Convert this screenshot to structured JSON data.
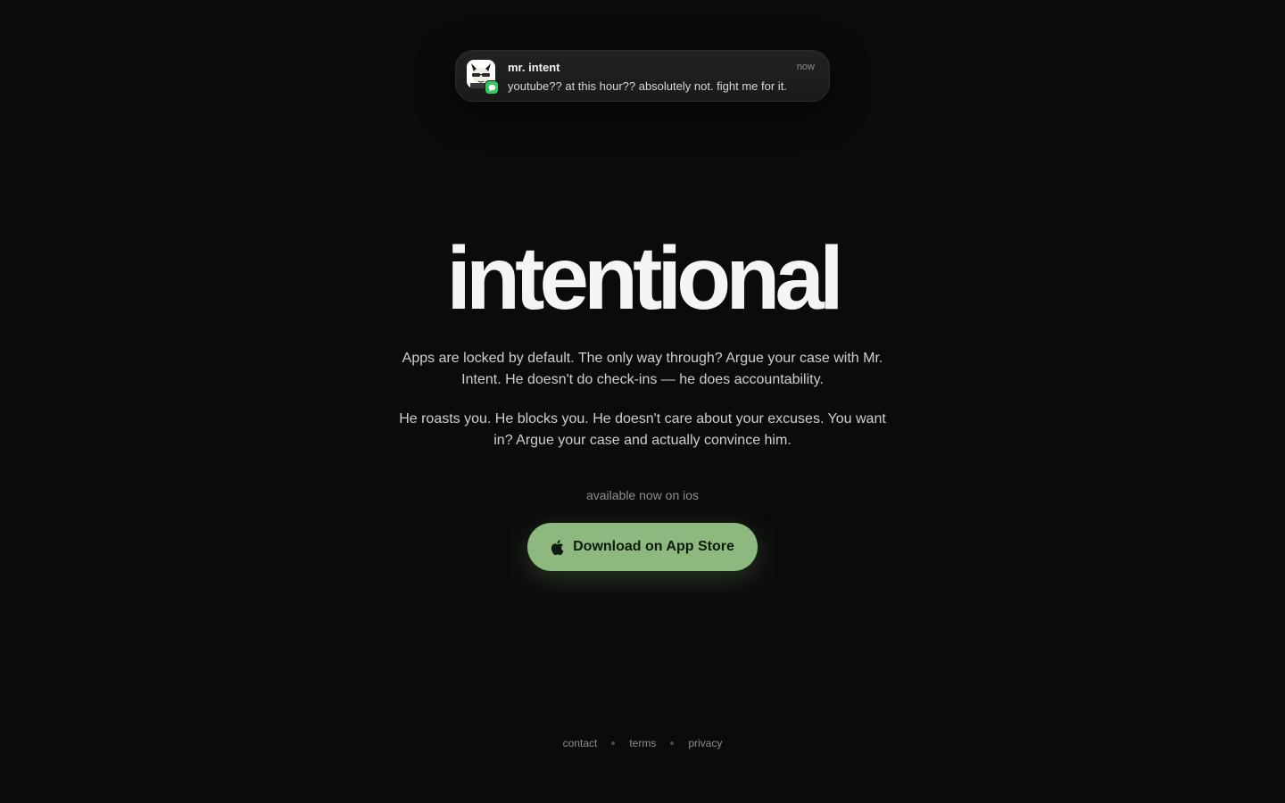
{
  "notification": {
    "sender": "mr. intent",
    "time": "now",
    "message": "youtube?? at this hour?? absolutely not. fight me for it.",
    "avatar_icon": "cat-mascot-icon",
    "badge_icon": "message-bubble-icon",
    "badge_color": "#34c759"
  },
  "hero": {
    "title": "intentional",
    "paragraph_1": "Apps are locked by default. The only way through? Argue your case with Mr. Intent. He doesn't do check-ins — he does accountability.",
    "paragraph_2": "He roasts you. He blocks you. He doesn't care about your excuses. You want in? Argue your case and actually convince him."
  },
  "availability": "available now on ios",
  "cta": {
    "label": "Download on App Store",
    "icon": "apple-logo-icon",
    "color": "#8db97f"
  },
  "footer": {
    "links": [
      "contact",
      "terms",
      "privacy"
    ]
  },
  "colors": {
    "background": "#0b0b0c",
    "accent": "#8db97f"
  }
}
